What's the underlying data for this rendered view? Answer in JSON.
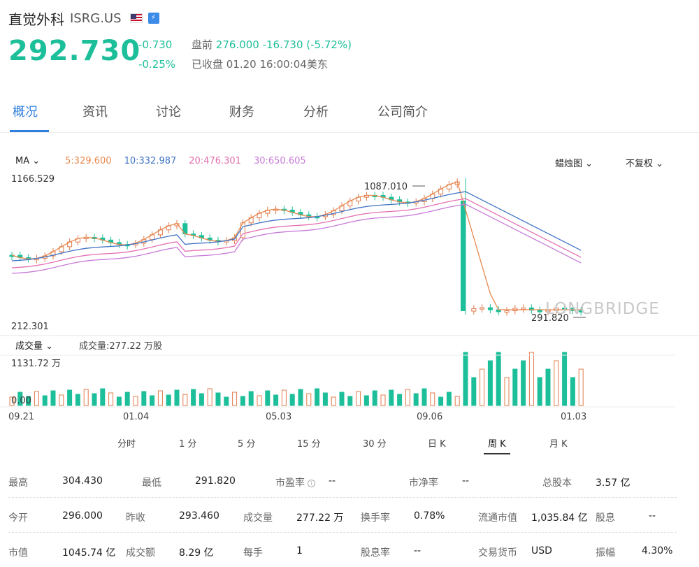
{
  "header": {
    "name": "直觉外科",
    "code": "ISRG.US",
    "flag_icon": "us-flag-icon",
    "badge_icon": "trade-badge-icon",
    "price": "292.730",
    "change": "-0.730",
    "change_pct": "-0.25%",
    "premarket_label": "盘前",
    "premarket_value": "276.000 -16.730 (-5.72%)",
    "status": "已收盘 01.20 16:00:04美东"
  },
  "tabs": [
    {
      "label": "概况"
    },
    {
      "label": "资讯"
    },
    {
      "label": "讨论"
    },
    {
      "label": "财务"
    },
    {
      "label": "分析"
    },
    {
      "label": "公司简介"
    }
  ],
  "chart": {
    "ma_label": "MA",
    "ma5": "5:329.600",
    "ma10": "10:332.987",
    "ma20": "20:476.301",
    "ma30": "30:650.605",
    "chart_type": "蜡烛图",
    "adjust": "不复权",
    "y_high": "1166.529",
    "y_low": "212.301",
    "peak_label": "1087.010",
    "trough_label": "291.820",
    "watermark": "LONGBRIDGE",
    "vol_label": "成交量",
    "vol_info": "成交量:277.22 万股",
    "vol_high": "1131.72 万",
    "vol_low": "0.00",
    "dates": [
      "09.21",
      "01.04",
      "05.03",
      "09.06",
      "01.03"
    ],
    "colors": {
      "up": "#e07b4b",
      "down": "#1dbf9a",
      "ma5": "#e8894f",
      "ma10": "#3f73c4",
      "ma20": "#e36fb0",
      "ma30": "#c77ad8"
    }
  },
  "periods": [
    {
      "label": "分时"
    },
    {
      "label": "1 分"
    },
    {
      "label": "5 分"
    },
    {
      "label": "15 分"
    },
    {
      "label": "30 分"
    },
    {
      "label": "日 K"
    },
    {
      "label": "周 K"
    },
    {
      "label": "月 K"
    }
  ],
  "stats": [
    [
      {
        "k": "最高",
        "v": "304.430"
      },
      {
        "k": "最低",
        "v": "291.820"
      },
      {
        "k": "市盈率",
        "v": "--"
      },
      {
        "k": "市净率",
        "v": "--"
      },
      {
        "k": "总股本",
        "v": "3.57 亿"
      }
    ],
    [
      {
        "k": "今开",
        "v": "296.000"
      },
      {
        "k": "昨收",
        "v": "293.460"
      },
      {
        "k": "成交量",
        "v": "277.22 万"
      },
      {
        "k": "换手率",
        "v": "0.78%"
      },
      {
        "k": "流通市值",
        "v": "1,035.84 亿"
      },
      {
        "k": "股息",
        "v": "--"
      }
    ],
    [
      {
        "k": "市值",
        "v": "1045.74 亿"
      },
      {
        "k": "成交额",
        "v": "8.29 亿"
      },
      {
        "k": "每手",
        "v": "1"
      },
      {
        "k": "股息率",
        "v": "--"
      },
      {
        "k": "交易货币",
        "v": "USD"
      },
      {
        "k": "振幅",
        "v": "4.30%"
      }
    ]
  ]
}
